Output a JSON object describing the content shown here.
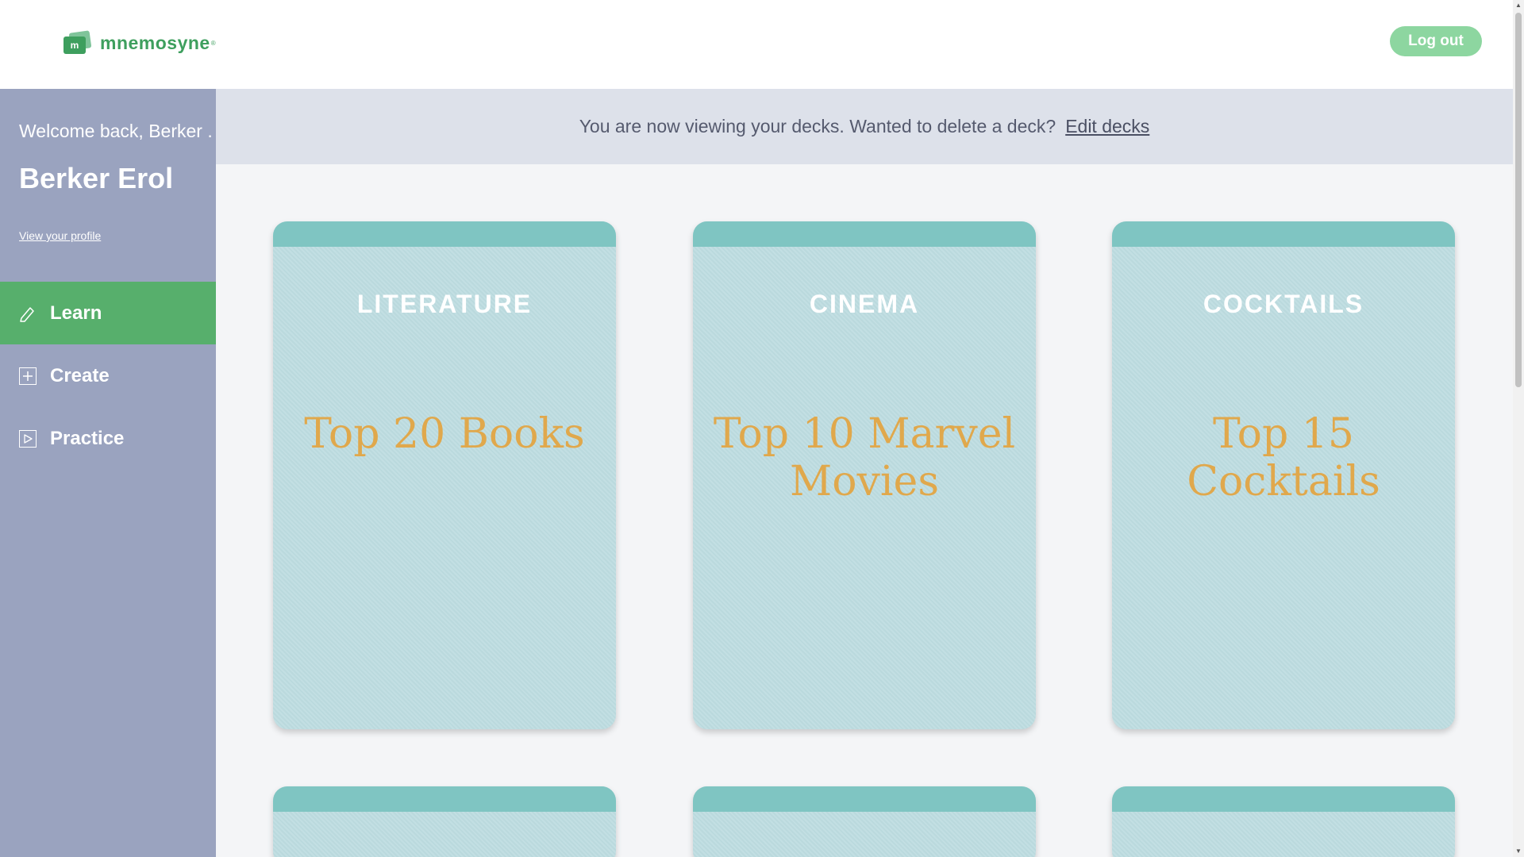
{
  "header": {
    "logo_letter": "m",
    "logo_text": "mnemosyne",
    "logo_mark": "®",
    "logout_label": "Log out",
    "accent_color": "#3e9f5e"
  },
  "sidebar": {
    "welcome": "Welcome back, Berker .",
    "user_name": "Berker Erol",
    "profile_link": "View your profile",
    "items": [
      {
        "label": "Learn",
        "icon": "pencil-icon",
        "active": true
      },
      {
        "label": "Create",
        "icon": "plus-square-icon",
        "active": false
      },
      {
        "label": "Practice",
        "icon": "play-square-icon",
        "active": false
      }
    ]
  },
  "banner": {
    "text": "You are now viewing your decks. Wanted to delete a deck?",
    "link": "Edit decks"
  },
  "decks": [
    {
      "category": "LITERATURE",
      "title": "Top 20 Books"
    },
    {
      "category": "CINEMA",
      "title": "Top 10 Marvel Movies"
    },
    {
      "category": "COCKTAILS",
      "title": "Top 15 Cocktails"
    }
  ],
  "scrollbar": {
    "up": "▲",
    "down": "▼"
  }
}
